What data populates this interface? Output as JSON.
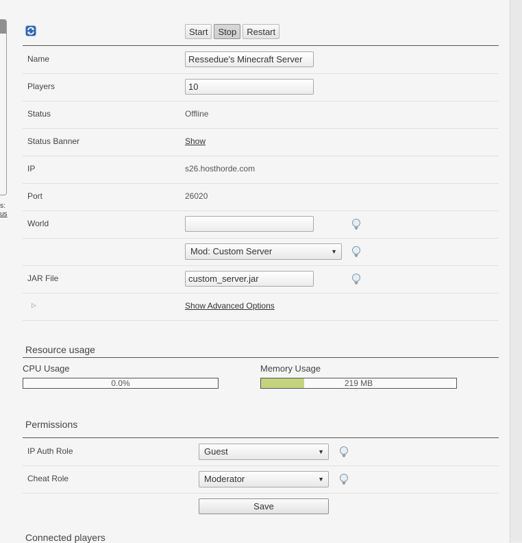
{
  "toolbar": {
    "refresh_icon": "refresh-icon",
    "buttons": [
      "Start",
      "Stop",
      "Restart"
    ]
  },
  "left_fragment": {
    "text1": "s:",
    "text2": "us"
  },
  "server": {
    "name_label": "Name",
    "name_value": "Ressedue's Minecraft Server",
    "players_label": "Players",
    "players_value": "10",
    "status_label": "Status",
    "status_value": "Offline",
    "banner_label": "Status Banner",
    "banner_link": "Show",
    "ip_label": "IP",
    "ip_value": "s26.hosthorde.com",
    "port_label": "Port",
    "port_value": "26020",
    "world_label": "World",
    "world_value": "",
    "mod_selected": "Mod: Custom Server",
    "jar_label": "JAR File",
    "jar_value": "custom_server.jar",
    "advanced_link": "Show Advanced Options"
  },
  "resources": {
    "title": "Resource usage",
    "cpu_label": "CPU Usage",
    "cpu_text": "0.0%",
    "cpu_fraction": 0.0,
    "mem_label": "Memory Usage",
    "mem_text": "219 MB",
    "mem_fraction": 0.22,
    "bar_fill_color": "#c3d37f"
  },
  "permissions": {
    "title": "Permissions",
    "ip_auth_label": "IP Auth Role",
    "ip_auth_value": "Guest",
    "cheat_label": "Cheat Role",
    "cheat_value": "Moderator",
    "save_label": "Save"
  },
  "connected_title": "Connected players"
}
